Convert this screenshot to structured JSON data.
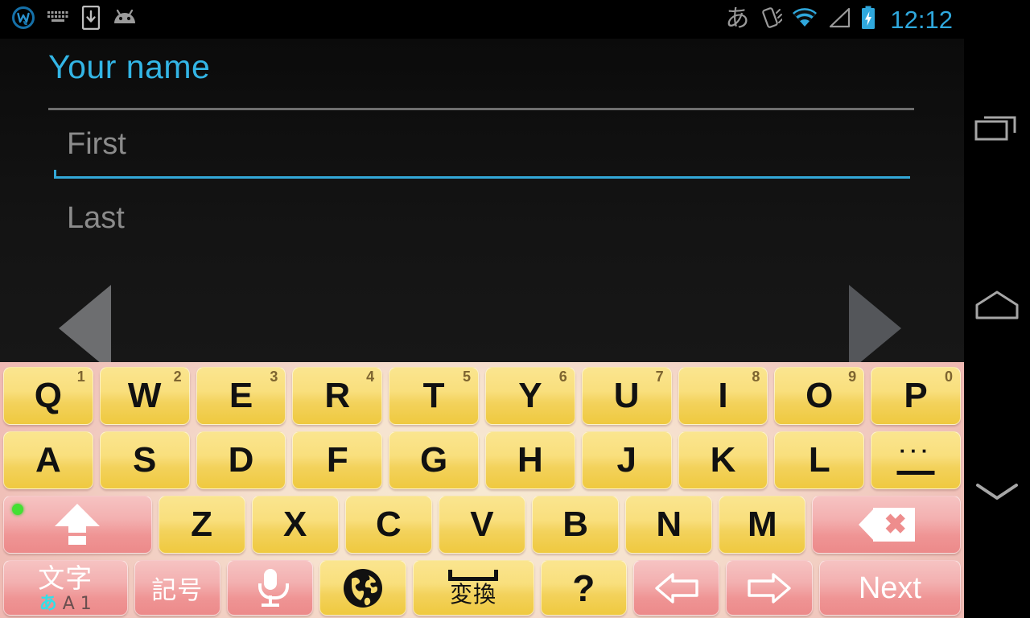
{
  "status_bar": {
    "left_icons": [
      {
        "name": "app-notification-icon",
        "glyph": "w-logo"
      },
      {
        "name": "keyboard-icon",
        "glyph": "keyboard"
      },
      {
        "name": "download-to-device-icon",
        "glyph": "phone-download"
      },
      {
        "name": "android-robot-icon",
        "glyph": "android-head"
      }
    ],
    "ime_indicator": "あ",
    "right_icons": [
      {
        "name": "vibrate-icon",
        "glyph": "vibrate"
      },
      {
        "name": "wifi-icon",
        "glyph": "wifi"
      },
      {
        "name": "signal-icon",
        "glyph": "signal-triangle"
      },
      {
        "name": "battery-charging-icon",
        "glyph": "battery-bolt"
      }
    ],
    "clock": "12:12",
    "clock_color": "#2fa8dd"
  },
  "form": {
    "title": "Your name",
    "title_color": "#33b5e5",
    "fields": [
      {
        "name": "first",
        "placeholder": "First",
        "value": "",
        "focused": true
      },
      {
        "name": "last",
        "placeholder": "Last",
        "value": "",
        "focused": false
      }
    ]
  },
  "overlay_nav": {
    "prev_label": "previous",
    "next_label": "next"
  },
  "keyboard": {
    "theme": {
      "key_yellow": "#f6d96b",
      "key_pink": "#f0a0a0",
      "bg_edge": "#eeb2ad",
      "bg_center": "#f7e9d2"
    },
    "row1": [
      {
        "label": "Q",
        "num": "1"
      },
      {
        "label": "W",
        "num": "2"
      },
      {
        "label": "E",
        "num": "3"
      },
      {
        "label": "R",
        "num": "4"
      },
      {
        "label": "T",
        "num": "5"
      },
      {
        "label": "Y",
        "num": "6"
      },
      {
        "label": "U",
        "num": "7"
      },
      {
        "label": "I",
        "num": "8"
      },
      {
        "label": "O",
        "num": "9"
      },
      {
        "label": "P",
        "num": "0"
      }
    ],
    "row2": [
      {
        "label": "A"
      },
      {
        "label": "S"
      },
      {
        "label": "D"
      },
      {
        "label": "F"
      },
      {
        "label": "G"
      },
      {
        "label": "H"
      },
      {
        "label": "J"
      },
      {
        "label": "K"
      },
      {
        "label": "L"
      }
    ],
    "row2_last": {
      "name": "dash-key",
      "dots": "···",
      "label": "—"
    },
    "row3": [
      {
        "label": "Z"
      },
      {
        "label": "X"
      },
      {
        "label": "C"
      },
      {
        "label": "V"
      },
      {
        "label": "B"
      },
      {
        "label": "N"
      },
      {
        "label": "M"
      }
    ],
    "shift_key": {
      "name": "shift-key",
      "indicator": "on"
    },
    "backspace_key": {
      "name": "backspace-key"
    },
    "row4": {
      "moji": {
        "main": "文字",
        "sub_active": "あ",
        "sub_inactive": "A 1"
      },
      "kigou": {
        "label": "記号"
      },
      "mic": {
        "label": "voice-input"
      },
      "globe": {
        "label": "language-switch"
      },
      "space": {
        "label": "変換"
      },
      "question": {
        "label": "?"
      },
      "left_arrow": {
        "label": "cursor-left"
      },
      "right_arrow": {
        "label": "cursor-right"
      },
      "next": {
        "label": "Next"
      }
    }
  },
  "navbar": {
    "recents": "recents",
    "home": "home",
    "hide_keyboard": "hide-keyboard"
  }
}
